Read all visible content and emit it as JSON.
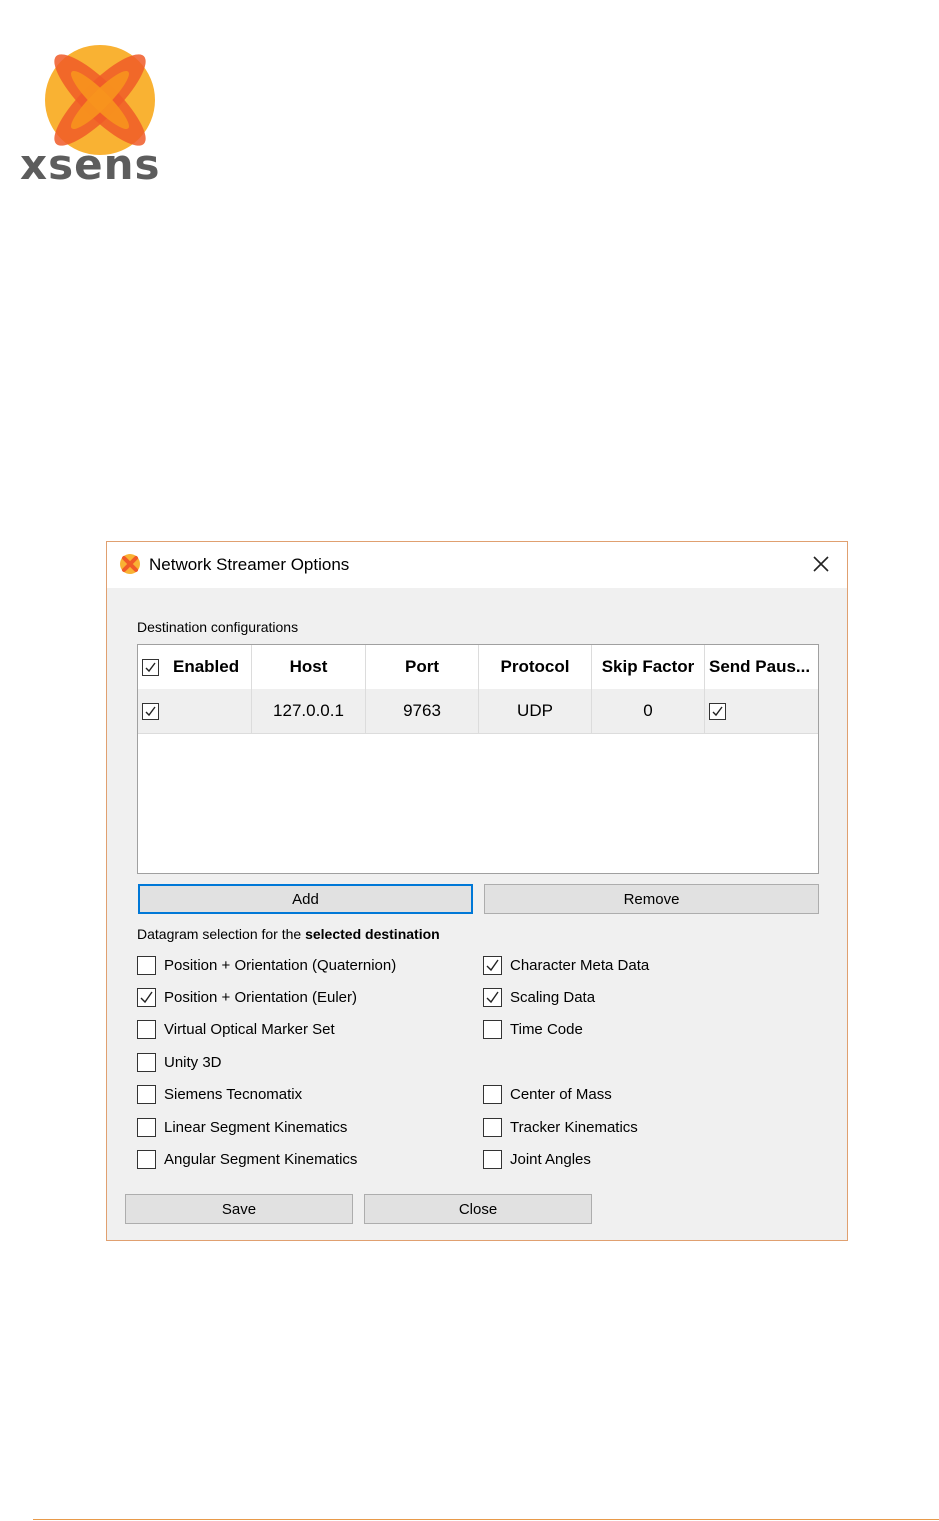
{
  "logo": {
    "text": "xsens",
    "brand_color": "#f5a623",
    "accent_color": "#f05a28"
  },
  "dialog": {
    "title": "Network Streamer Options",
    "title_icon": "xsens-x-icon",
    "close_icon": "close-icon",
    "destination_label": "Destination configurations",
    "table": {
      "columns": [
        "Enabled",
        "Host",
        "Port",
        "Protocol",
        "Skip Factor",
        "Send Paus..."
      ],
      "header_enabled_checked": true,
      "rows": [
        {
          "enabled": true,
          "host": "127.0.0.1",
          "port": "9763",
          "protocol": "UDP",
          "skip_factor": "0",
          "send_paused": true
        }
      ]
    },
    "buttons": {
      "add": "Add",
      "remove": "Remove",
      "save": "Save",
      "close": "Close"
    },
    "datagram_label_prefix": "Datagram selection for the ",
    "datagram_label_bold": "selected destination",
    "options": [
      {
        "label": "Position + Orientation (Quaternion)",
        "checked": false
      },
      {
        "label": "Character Meta Data",
        "checked": true
      },
      {
        "label": "Position + Orientation (Euler)",
        "checked": true
      },
      {
        "label": "Scaling Data",
        "checked": true
      },
      {
        "label": "Virtual Optical Marker Set",
        "checked": false
      },
      {
        "label": "Time Code",
        "checked": false
      },
      {
        "label": "Unity 3D",
        "checked": false
      },
      {
        "label": "Siemens Tecnomatix",
        "checked": false
      },
      {
        "label": "Center of Mass",
        "checked": false
      },
      {
        "label": "Linear Segment Kinematics",
        "checked": false
      },
      {
        "label": "Tracker Kinematics",
        "checked": false
      },
      {
        "label": "Angular Segment Kinematics",
        "checked": false
      },
      {
        "label": "Joint Angles",
        "checked": false
      }
    ]
  }
}
